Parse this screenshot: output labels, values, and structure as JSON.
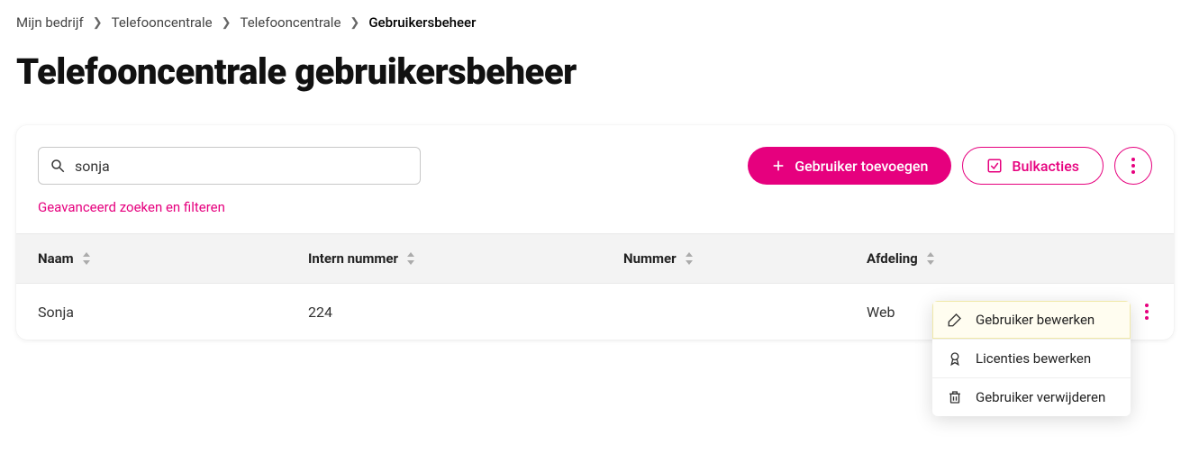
{
  "breadcrumb": {
    "items": [
      "Mijn bedrijf",
      "Telefooncentrale",
      "Telefooncentrale"
    ],
    "current": "Gebruikersbeheer"
  },
  "title": "Telefooncentrale gebruikersbeheer",
  "search": {
    "value": "sonja",
    "advanced_label": "Geavanceerd zoeken en filteren"
  },
  "buttons": {
    "add_user": "Gebruiker toevoegen",
    "bulk": "Bulkacties"
  },
  "table": {
    "headers": {
      "name": "Naam",
      "intern": "Intern nummer",
      "nummer": "Nummer",
      "afdeling": "Afdeling"
    },
    "rows": [
      {
        "name": "Sonja",
        "intern": "224",
        "nummer": "",
        "afdeling": "Web"
      }
    ]
  },
  "context_menu": {
    "edit_user": "Gebruiker bewerken",
    "edit_licenses": "Licenties bewerken",
    "delete_user": "Gebruiker verwijderen"
  }
}
